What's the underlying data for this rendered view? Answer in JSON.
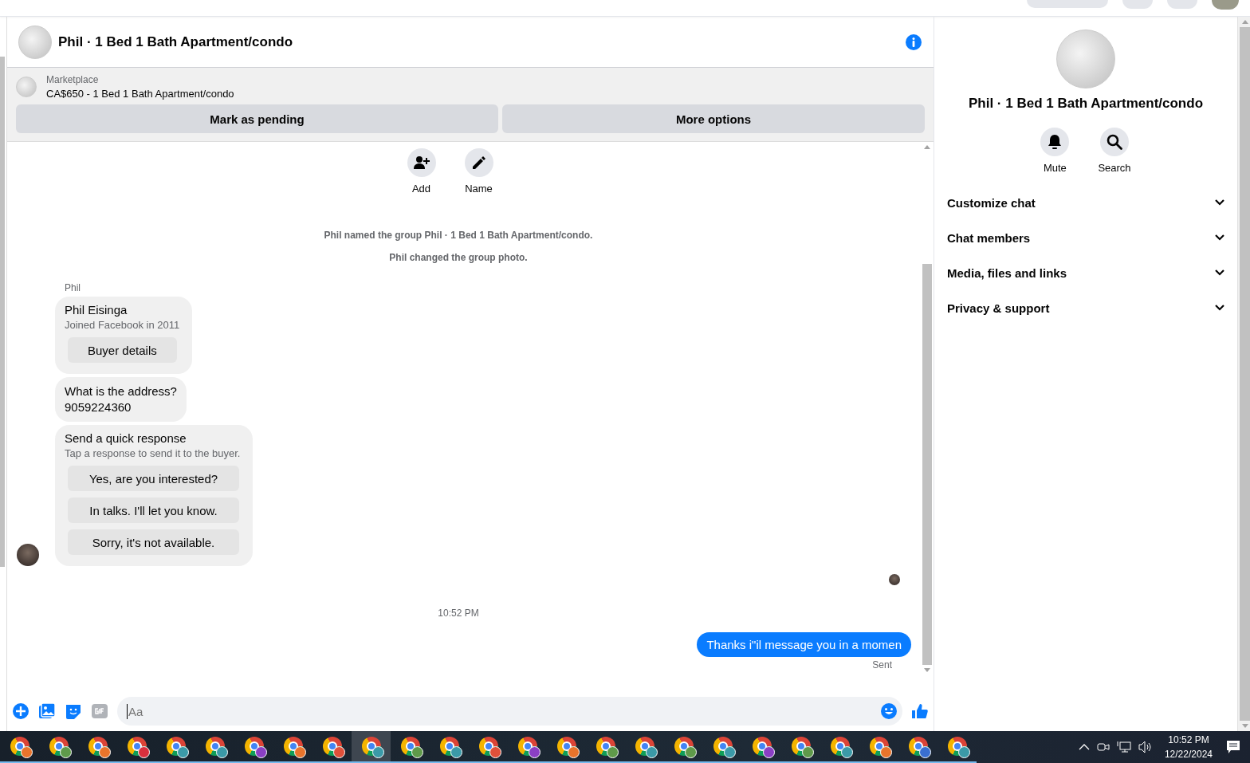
{
  "chat": {
    "title": "Phil · 1 Bed 1 Bath Apartment/condo",
    "listing": {
      "source": "Marketplace",
      "summary": "CA$650 - 1 Bed 1 Bath Apartment/condo"
    },
    "listing_buttons": [
      "Mark as pending",
      "More options"
    ],
    "group_actions": [
      {
        "label": "Add",
        "kind": "add"
      },
      {
        "label": "Name",
        "kind": "name"
      }
    ],
    "notices": [
      "Phil named the group Phil · 1 Bed 1 Bath Apartment/condo.",
      "Phil changed the group photo."
    ],
    "sender": "Phil",
    "messages": [
      {
        "kind": "profile",
        "name": "Phil Eisinga",
        "subtitle": "Joined Facebook in 2011",
        "button": "Buyer details"
      },
      {
        "kind": "text",
        "lines": [
          "What is the address?",
          "9059224360"
        ]
      },
      {
        "kind": "quick_responses",
        "title": "Send a quick response",
        "subtitle": "Tap a response to send it to the buyer.",
        "options": [
          "Yes, are you interested?",
          "In talks. I'll let you know.",
          "Sorry, it's not available."
        ]
      }
    ],
    "timestamp": "10:52 PM",
    "sent_message": "Thanks i\"il message you in a momen",
    "sent_status": "Sent",
    "composer": {
      "placeholder": "Aa"
    }
  },
  "details_panel": {
    "title": "Phil · 1 Bed 1 Bath Apartment/condo",
    "actions": [
      {
        "label": "Mute",
        "kind": "mute"
      },
      {
        "label": "Search",
        "kind": "search"
      }
    ],
    "sections": [
      {
        "label": "Customize chat",
        "expanded": false
      },
      {
        "label": "Chat members",
        "expanded": false
      },
      {
        "label": "Media, files and links",
        "expanded": false
      },
      {
        "label": "Privacy & support",
        "expanded": false
      }
    ]
  },
  "taskbar": {
    "apps": [
      {
        "color": "#e8742c",
        "selected": false
      },
      {
        "color": "#5f9a4a",
        "selected": false
      },
      {
        "color": "#e8742c",
        "selected": false
      },
      {
        "color": "#d9303e",
        "selected": false
      },
      {
        "color": "#3b9aa8",
        "selected": false
      },
      {
        "color": "#3b9aa8",
        "selected": false
      },
      {
        "color": "#8a3fc4",
        "selected": false
      },
      {
        "color": "#e8742c",
        "selected": false
      },
      {
        "color": "#e0503a",
        "selected": false
      },
      {
        "color": "#3b9aa8",
        "selected": true
      },
      {
        "color": "#5f9a4a",
        "selected": false
      },
      {
        "color": "#3b9aa8",
        "selected": false
      },
      {
        "color": "#e0503a",
        "selected": false
      },
      {
        "color": "#8a3fc4",
        "selected": false
      },
      {
        "color": "#e8742c",
        "selected": false
      },
      {
        "color": "#5f9a4a",
        "selected": false
      },
      {
        "color": "#3b9aa8",
        "selected": false
      },
      {
        "color": "#5f9a4a",
        "selected": false
      },
      {
        "color": "#3b9aa8",
        "selected": false
      },
      {
        "color": "#8a3fc4",
        "selected": false
      },
      {
        "color": "#5f9a4a",
        "selected": false
      },
      {
        "color": "#3b9aa8",
        "selected": false
      },
      {
        "color": "#e8742c",
        "selected": false
      },
      {
        "color": "#3a6fd0",
        "selected": false
      },
      {
        "color": "#3b9aa8",
        "selected": false
      }
    ],
    "clock": {
      "time": "10:52 PM",
      "date": "12/22/2024"
    }
  }
}
